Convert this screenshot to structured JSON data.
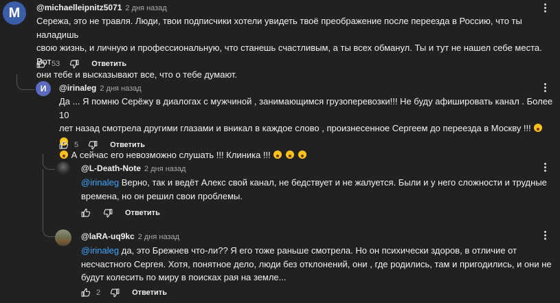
{
  "comments": [
    {
      "author": "@michaelleipnitz5071",
      "avatar_letter": "M",
      "avatar_color": "#3b5ea8",
      "time": "2 дня назад",
      "lines": [
        "Сережа, это не травля. Люди, твои подписчики хотели увидеть твоё преображение после переезда в Россию, что ты наладишь",
        "свою жизнь, и личную и профессиональную, что станешь счастливым, а ты всех обманул. Ты и тут не нашел себе места. Вот",
        "они тебе и высказывают все, что о тебе думают."
      ],
      "likes": "53",
      "reply_label": "Ответить"
    },
    {
      "author": "@irinaleg",
      "avatar_letter": "И",
      "avatar_color": "#5c6bc0",
      "time": "2 дня назад",
      "lines": [
        "Да ... Я помню Серёжу в диалогах с мужчиной , занимающимся грузоперевозки!!! Не буду афишировать канал . Более 10",
        "лет назад смотрела другими глазами и вникал в каждое слово , произнесенное Сергеем до переезда в Москву !!!",
        "А сейчас его невозможно слушать !!! Клиника !!!"
      ],
      "emoji_name": "astonished-face-emoji",
      "likes": "5",
      "reply_label": "Ответить"
    },
    {
      "author": "@L-Death-Note",
      "time": "2 дня назад",
      "mention": "@irinaleg",
      "lines": [
        "Верно, так и ведёт Алекс свой канал, не бедствует и не жалуется. Были и у него сложности и трудные",
        "времена, но он решил свои проблемы."
      ],
      "likes": "",
      "reply_label": "Ответить"
    },
    {
      "author": "@laRA-uq9kc",
      "time": "2 дня назад",
      "mention": "@irinaleg",
      "lines": [
        "да, это Брежнев что-ли??  Я его тоже раньше смотрела. Но он психически здоров, в отличие от",
        "несчастного Сергея. Хотя, понятное дело, люди без отклонений, они , где родились, там и пригодились, и они  не",
        "будут колесить по миру в поисках рая на земле..."
      ],
      "likes": "2",
      "reply_label": "Ответить"
    }
  ],
  "icons": {
    "like": "thumbs-up-icon",
    "dislike": "thumbs-down-icon",
    "menu": "more-vertical-icon"
  }
}
